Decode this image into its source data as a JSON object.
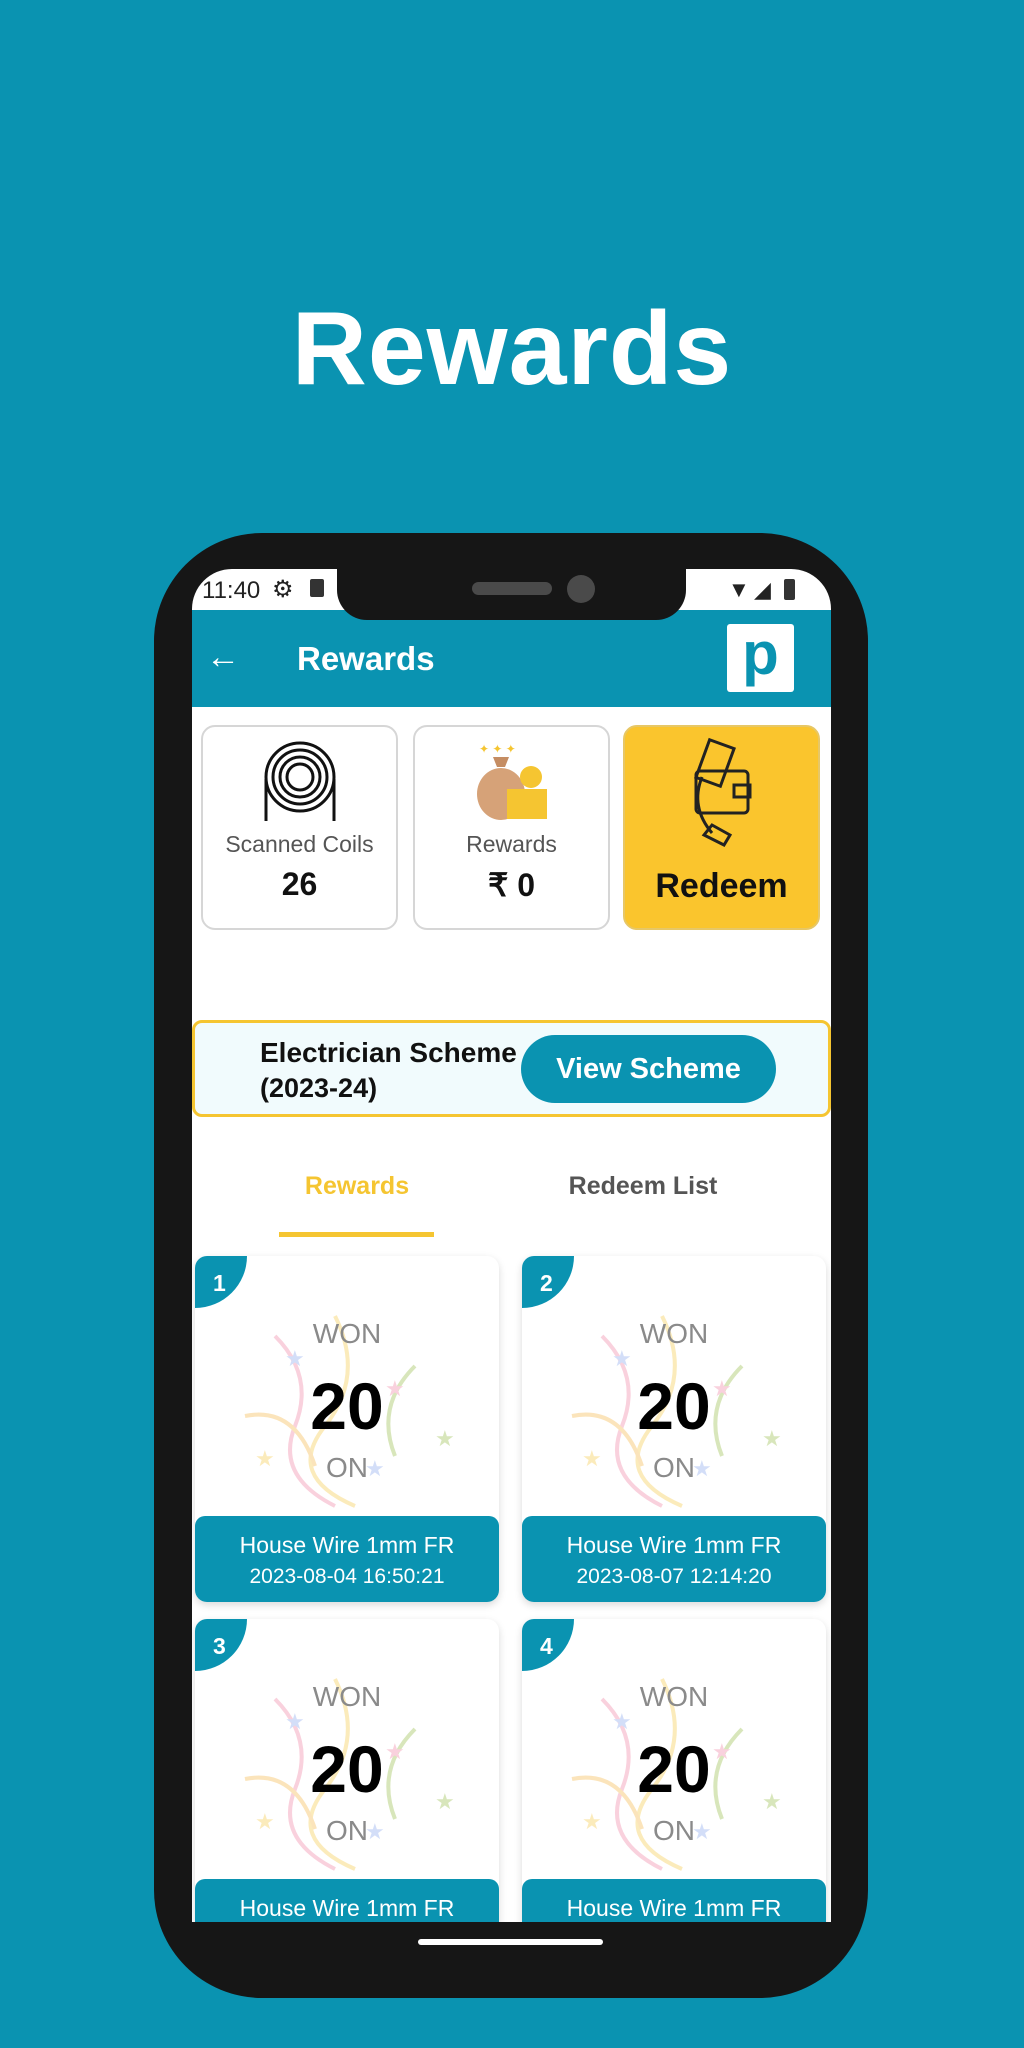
{
  "headline": "Rewards",
  "status_bar": {
    "time": "11:40"
  },
  "app_bar": {
    "title": "Rewards",
    "logo_letter": "p"
  },
  "stats": {
    "scanned_coils": {
      "label": "Scanned Coils",
      "value": "26"
    },
    "rewards": {
      "label": "Rewards",
      "value": "₹ 0"
    },
    "redeem": {
      "label": "Redeem"
    }
  },
  "scheme": {
    "name": "Electrician Scheme",
    "year": "(2023-24)",
    "button": "View Scheme"
  },
  "tabs": [
    {
      "label": "Rewards",
      "active": true
    },
    {
      "label": "Redeem List",
      "active": false
    }
  ],
  "reward_cards": [
    {
      "index": "1",
      "won": "WON",
      "amount": "20",
      "on": "ON",
      "product": "House Wire 1mm FR",
      "date": "2023-08-04 16:50:21"
    },
    {
      "index": "2",
      "won": "WON",
      "amount": "20",
      "on": "ON",
      "product": "House Wire 1mm FR",
      "date": "2023-08-07 12:14:20"
    },
    {
      "index": "3",
      "won": "WON",
      "amount": "20",
      "on": "ON",
      "product": "House Wire 1mm FR"
    },
    {
      "index": "4",
      "won": "WON",
      "amount": "20",
      "on": "ON",
      "product": "House Wire 1mm FR"
    }
  ],
  "colors": {
    "brand": "#0a93b1",
    "accent": "#f5c531",
    "redeem_bg": "#fac52d"
  }
}
